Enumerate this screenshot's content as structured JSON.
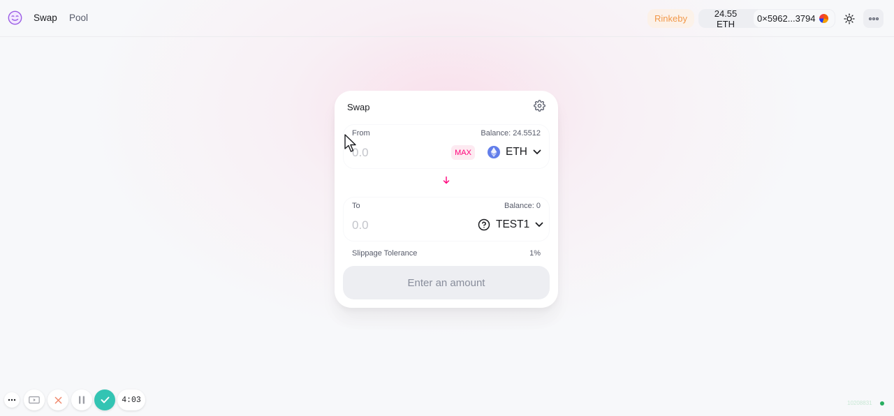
{
  "header": {
    "logo_icon": "unicorn-logo-icon",
    "nav": [
      {
        "label": "Swap",
        "active": true
      },
      {
        "label": "Pool",
        "active": false
      }
    ],
    "network": "Rinkeby",
    "eth_balance": "24.55 ETH",
    "address": "0×5962...3794",
    "theme_icon": "sun-icon",
    "menu_icon": "ellipsis-icon"
  },
  "swap": {
    "title": "Swap",
    "settings_icon": "gear-icon",
    "from": {
      "label": "From",
      "balance": "Balance: 24.5512",
      "placeholder": "0.0",
      "max_label": "MAX",
      "token": "ETH",
      "token_icon": "ethereum-icon"
    },
    "arrow_icon": "arrow-down-icon",
    "to": {
      "label": "To",
      "balance": "Balance: 0",
      "placeholder": "0.0",
      "token": "TEST1",
      "token_icon": "question-circle-icon"
    },
    "slippage_label": "Slippage Tolerance",
    "slippage_value": "1%",
    "submit_label": "Enter an amount"
  },
  "recorder": {
    "timer": "4:03",
    "icons": [
      "ellipsis-icon",
      "camera-icon",
      "close-icon",
      "pause-icon",
      "check-icon"
    ]
  },
  "status": {
    "block_number": "10208831"
  },
  "colors": {
    "accent_pink": "#ff007a",
    "network_orange": "#f2994a",
    "recorder_teal": "#33c4b3",
    "status_green": "#27ae60"
  }
}
